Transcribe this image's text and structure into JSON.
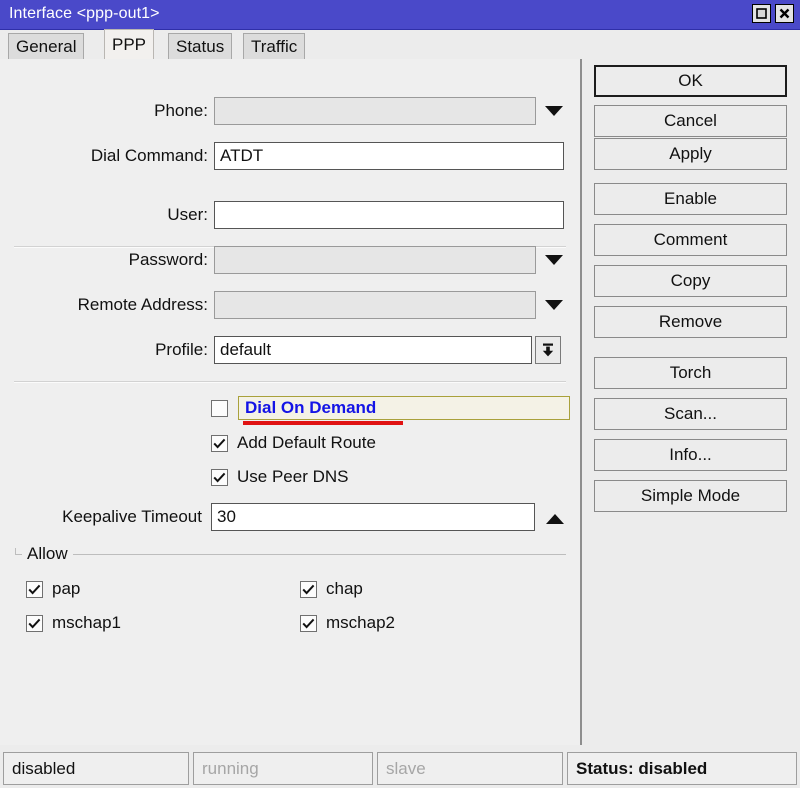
{
  "window": {
    "title": "Interface <ppp-out1>",
    "titlebar_color": "#4a49c9",
    "buttons": [
      {
        "name": "maximize-button",
        "icon": "maximize-icon"
      },
      {
        "name": "close-button",
        "icon": "close-icon"
      }
    ]
  },
  "tabs": [
    {
      "label": "General",
      "active": false
    },
    {
      "label": "PPP",
      "active": true
    },
    {
      "label": "Status",
      "active": false
    },
    {
      "label": "Traffic",
      "active": false
    }
  ],
  "form": {
    "fields": [
      {
        "label": "Phone:",
        "value": "",
        "disabled": true,
        "dropdown": "caret"
      },
      {
        "label": "Dial Command:",
        "value": "ATDT",
        "disabled": false,
        "dropdown": "none"
      },
      {
        "label": "User:",
        "value": "",
        "disabled": false,
        "dropdown": "none"
      },
      {
        "label": "Password:",
        "value": "",
        "disabled": true,
        "dropdown": "caret"
      },
      {
        "label": "Remote Address:",
        "value": "",
        "disabled": true,
        "dropdown": "caret"
      },
      {
        "label": "Profile:",
        "value": "default",
        "disabled": false,
        "dropdown": "button"
      }
    ],
    "checkboxes": [
      {
        "label": "Dial On Demand",
        "checked": false,
        "highlighted": true
      },
      {
        "label": "Add Default Route",
        "checked": true,
        "highlighted": false
      },
      {
        "label": "Use Peer DNS",
        "checked": true,
        "highlighted": false
      }
    ],
    "keepalive": {
      "label": "Keepalive Timeout",
      "value": "30",
      "spinner": "up-arrow"
    },
    "allow": {
      "title": "Allow",
      "items": [
        {
          "label": "pap",
          "checked": true,
          "column": "left"
        },
        {
          "label": "chap",
          "checked": true,
          "column": "right"
        },
        {
          "label": "mschap1",
          "checked": true,
          "column": "left"
        },
        {
          "label": "mschap2",
          "checked": true,
          "column": "right"
        }
      ]
    },
    "highlight": {
      "text_color": "#1414e6",
      "underline_color": "#e01212",
      "box_color": "#a9a13b"
    }
  },
  "actions": [
    {
      "label": "OK",
      "default": true,
      "gap_before": false
    },
    {
      "label": "Cancel",
      "default": false,
      "gap_before": false
    },
    {
      "label": "Apply",
      "default": false,
      "gap_before": false
    },
    {
      "label": "Enable",
      "default": false,
      "gap_before": true
    },
    {
      "label": "Comment",
      "default": false,
      "gap_before": false
    },
    {
      "label": "Copy",
      "default": false,
      "gap_before": false
    },
    {
      "label": "Remove",
      "default": false,
      "gap_before": false
    },
    {
      "label": "Torch",
      "default": false,
      "gap_before": true
    },
    {
      "label": "Scan...",
      "default": false,
      "gap_before": false
    },
    {
      "label": "Info...",
      "default": false,
      "gap_before": false
    },
    {
      "label": "Simple Mode",
      "default": false,
      "gap_before": false
    }
  ],
  "statusbar": [
    {
      "text": "disabled",
      "muted": false,
      "bold": false
    },
    {
      "text": "running",
      "muted": true,
      "bold": false
    },
    {
      "text": "slave",
      "muted": true,
      "bold": false
    },
    {
      "text": "Status: disabled",
      "muted": false,
      "bold": true
    }
  ]
}
